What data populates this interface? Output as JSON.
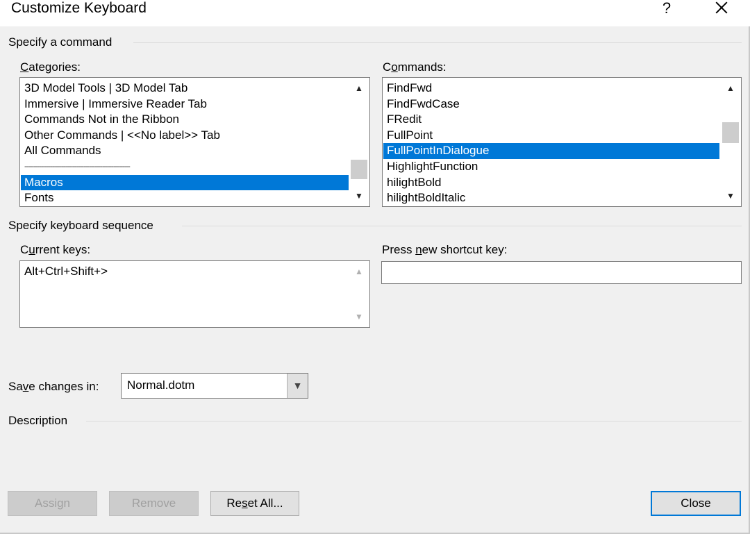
{
  "window": {
    "title": "Customize Keyboard",
    "help_glyph": "?"
  },
  "specify_command": {
    "group_label": "Specify a command",
    "categories": {
      "label_u": "C",
      "label_rest": "ategories:",
      "items": [
        "3D Model Tools | 3D Model Tab",
        "Immersive | Immersive Reader Tab",
        "Commands Not in the Ribbon",
        "Other Commands | <<No label>> Tab",
        "All Commands",
        "---------------------------------------------------------",
        "Macros",
        "Fonts"
      ],
      "selected": "Macros"
    },
    "commands": {
      "label_pre": "C",
      "label_u": "o",
      "label_rest": "mmands:",
      "items": [
        "FindFwd",
        "FindFwdCase",
        "FRedit",
        "FullPoint",
        "FullPointInDialogue",
        "HighlightFunction",
        "hilightBold",
        "hilightBoldItalic"
      ],
      "selected": "FullPointInDialogue"
    }
  },
  "keyboard_sequence": {
    "group_label": "Specify keyboard sequence",
    "current_keys": {
      "label_u": "u",
      "label_pre": "C",
      "label_rest": "rrent keys:",
      "value": "Alt+Ctrl+Shift+>"
    },
    "new_shortcut": {
      "label_pre": "Press ",
      "label_u": "n",
      "label_rest": "ew shortcut key:",
      "value": ""
    }
  },
  "save_changes": {
    "label_pre": "Sa",
    "label_u": "v",
    "label_rest": "e changes in:",
    "value": "Normal.dotm"
  },
  "description": {
    "group_label": "Description",
    "text": ""
  },
  "buttons": {
    "assign": "Assign",
    "remove": "Remove",
    "reset_pre": "Re",
    "reset_u": "s",
    "reset_rest": "et All...",
    "close": "Close"
  }
}
